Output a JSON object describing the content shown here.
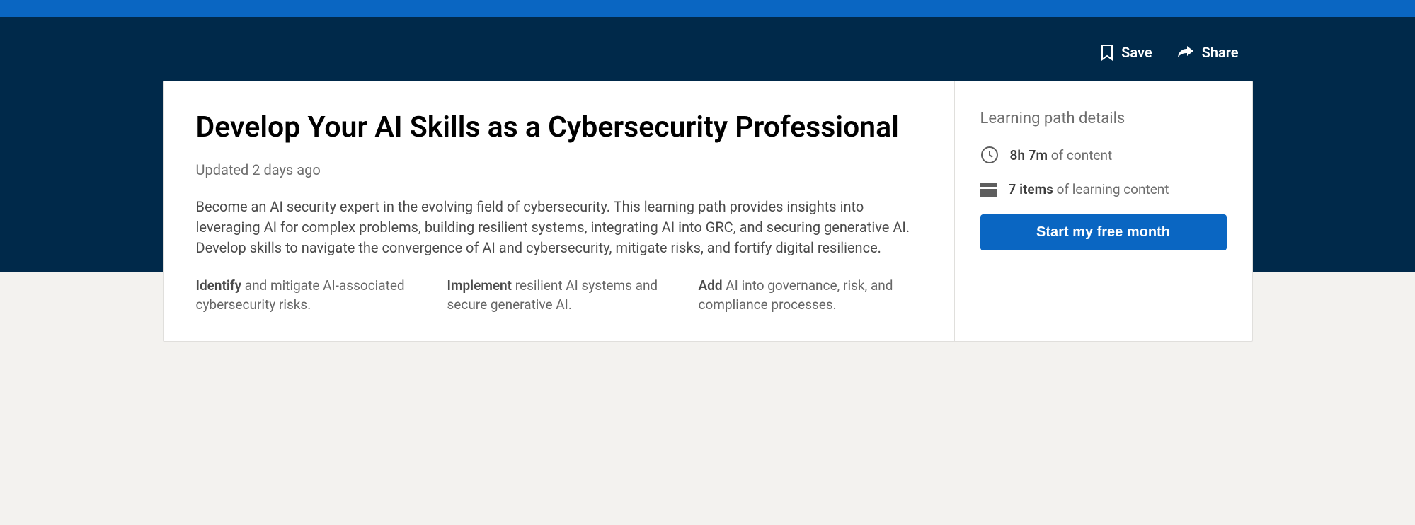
{
  "actions": {
    "save": "Save",
    "share": "Share"
  },
  "title": "Develop Your AI Skills as a Cybersecurity Professional",
  "updated": "Updated 2 days ago",
  "description": "Become an AI security expert in the evolving field of cybersecurity. This learning path provides insights into leveraging AI for complex problems, building resilient systems, integrating AI into GRC, and securing generative AI. Develop skills to navigate the convergence of AI and cybersecurity, mitigate risks, and fortify digital resilience.",
  "bullets": [
    {
      "strong": "Identify",
      "rest": " and mitigate AI-associated cybersecurity risks."
    },
    {
      "strong": "Implement",
      "rest": " resilient AI systems and secure generative AI."
    },
    {
      "strong": "Add",
      "rest": " AI into governance, risk, and compliance processes."
    }
  ],
  "details": {
    "heading": "Learning path details",
    "duration_strong": "8h 7m",
    "duration_rest": " of content",
    "items_strong": "7 items",
    "items_rest": " of learning content",
    "cta": "Start my free month"
  }
}
